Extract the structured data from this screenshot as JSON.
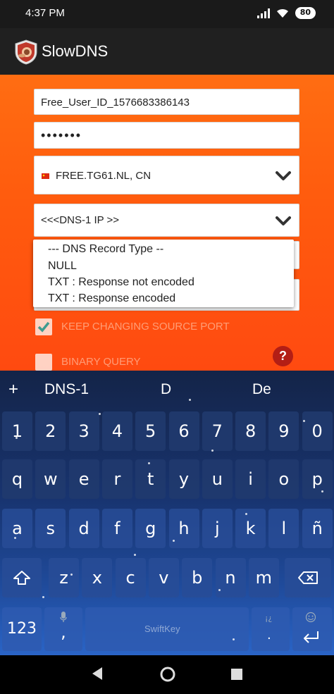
{
  "status": {
    "time": "4:37 PM",
    "battery": "80"
  },
  "app": {
    "title": "SlowDNS"
  },
  "form": {
    "user_id": "Free_User_ID_1576683386143",
    "password_mask": "•••••••",
    "server": "FREE.TG61.NL, CN",
    "dns_ip_placeholder": "<<<DNS-1 IP >>"
  },
  "dropdown": {
    "items": [
      "--- DNS Record Type --",
      "NULL",
      "TXT : Response not encoded",
      "TXT : Response encoded"
    ]
  },
  "checkboxes": [
    {
      "label": "KEEP CHANGING SOURCE PORT",
      "checked": true
    },
    {
      "label": "BINARY QUERY",
      "checked": false
    }
  ],
  "help": {
    "label": "?"
  },
  "keyboard": {
    "suggestions": {
      "plus": "+",
      "left": "DNS-1",
      "center": "D",
      "right": "De"
    },
    "row_numbers": [
      "1",
      "2",
      "3",
      "4",
      "5",
      "6",
      "7",
      "8",
      "9",
      "0"
    ],
    "row_q": [
      "q",
      "w",
      "e",
      "r",
      "t",
      "y",
      "u",
      "i",
      "o",
      "p"
    ],
    "row_a": [
      "a",
      "s",
      "d",
      "f",
      "g",
      "h",
      "j",
      "l",
      "ñ"
    ],
    "row_a_fix": [
      "a",
      "s",
      "d",
      "f",
      "g",
      "h",
      "j",
      "k",
      "l",
      "ñ"
    ],
    "row_z": [
      "z",
      "x",
      "c",
      "v",
      "b",
      "n",
      "m"
    ],
    "numeric_key": "123",
    "comma_key": ",",
    "space_label": "SwiftKey",
    "punct_key": ".,!?",
    "punct_sub": "¡¿",
    "accent_color": "#2a64c6"
  },
  "icons": {
    "shift": "shift-icon",
    "backspace": "backspace-icon",
    "enter": "enter-icon",
    "mic": "mic-icon",
    "emoji": "emoji-icon",
    "nav_back": "back-triangle-icon",
    "nav_home": "home-circle-icon",
    "nav_recents": "recents-square-icon"
  }
}
